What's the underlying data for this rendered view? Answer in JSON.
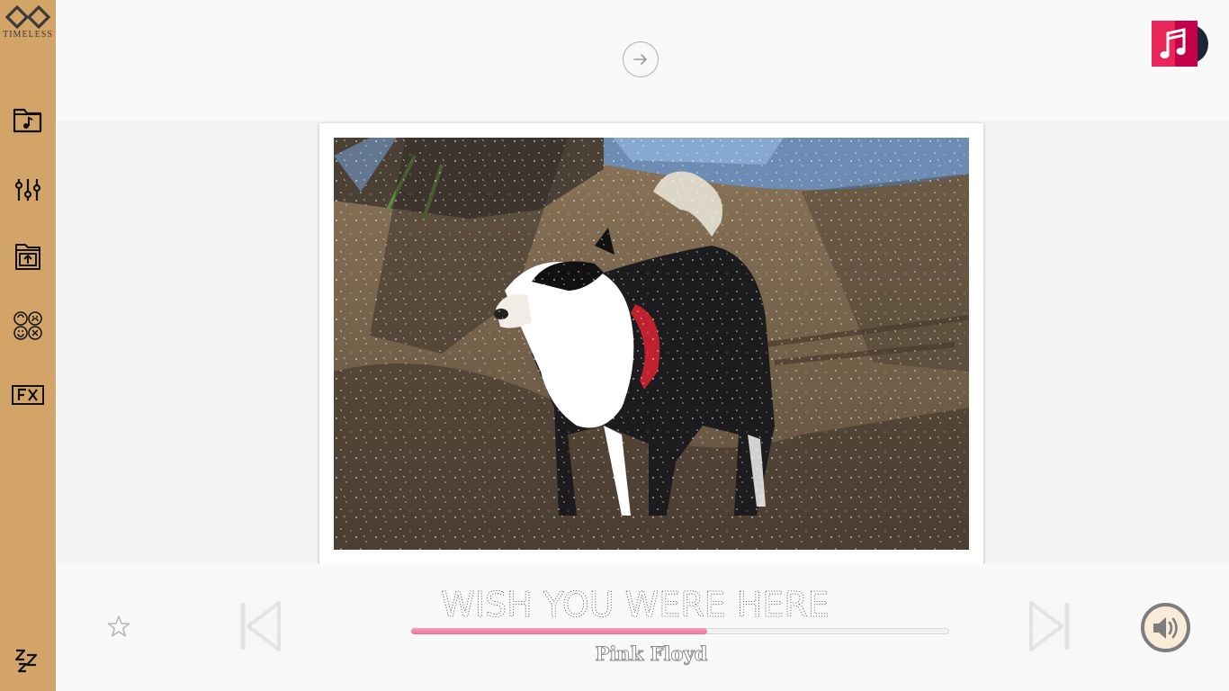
{
  "app": {
    "name": "TIMELESS"
  },
  "sidebar": {
    "items": [
      {
        "icon": "music-folder-icon"
      },
      {
        "icon": "equalizer-sliders-icon"
      },
      {
        "icon": "upload-folder-icon"
      },
      {
        "icon": "moods-faces-icon"
      },
      {
        "icon": "fx-icon"
      },
      {
        "icon": "sleep-zzz-icon"
      }
    ],
    "color": "#d3a467"
  },
  "header": {
    "next_icon": "arrow-right-icon",
    "badge_icon": "music-note-icon",
    "badge_colors": [
      "#e8265a",
      "#c5004a",
      "#1e2436"
    ]
  },
  "now_playing": {
    "title": "WISH YOU WERE HERE",
    "artist": "Pink Floyd",
    "progress": 0.55,
    "progress_color": "#ec6f9b",
    "favorite_icon": "star-outline-icon",
    "prev_icon": "skip-previous-icon",
    "next_icon": "skip-next-icon",
    "volume_icon": "speaker-volume-icon"
  }
}
